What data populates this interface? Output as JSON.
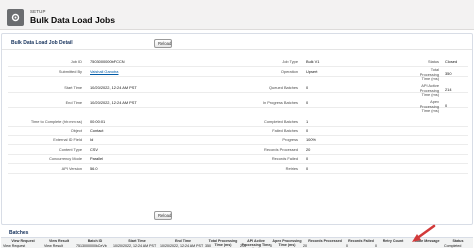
{
  "header": {
    "setup_label": "SETUP",
    "title": "Bulk Data Load Jobs"
  },
  "panel": {
    "title": "Bulk Data Load Job Detail",
    "reload_label": "Reload"
  },
  "detail": {
    "col1": [
      {
        "label": "Job ID",
        "value": "7503000000bFCCN"
      },
      {
        "label": "Submitted By",
        "value": "Vaishali Ganotra",
        "link": true
      },
      {
        "label": "Start Time",
        "value": "10/20/2022, 12:24 AM PST"
      },
      {
        "label": "End Time",
        "value": "10/20/2022, 12:24 AM PST"
      },
      {
        "label": "Time to Complete (hh:mm:ss)",
        "value": "00:00:01"
      },
      {
        "label": "Object",
        "value": "Contact"
      },
      {
        "label": "External ID Field",
        "value": "Id"
      },
      {
        "label": "Content Type",
        "value": "CSV"
      },
      {
        "label": "Concurrency Mode",
        "value": "Parallel"
      },
      {
        "label": "API Version",
        "value": "56.0"
      }
    ],
    "col2": [
      {
        "label": "Job Type",
        "value": "Bulk V1"
      },
      {
        "label": "Operation",
        "value": "Upsert"
      },
      {
        "label": "Queued Batches",
        "value": "0"
      },
      {
        "label": "In Progress Batches",
        "value": "0"
      },
      {
        "label": "Completed Batches",
        "value": "1"
      },
      {
        "label": "Failed Batches",
        "value": "0"
      },
      {
        "label": "Progress",
        "value": "100%"
      },
      {
        "label": "Records Processed",
        "value": "20"
      },
      {
        "label": "Records Failed",
        "value": "0"
      },
      {
        "label": "Retries",
        "value": "0"
      }
    ],
    "col3": [
      {
        "label": "Status",
        "value": "Closed"
      },
      {
        "label": "Total Processing Time (ms)",
        "value": "350"
      },
      {
        "label": "API Active Processing Time (ms)",
        "value": "214"
      },
      {
        "label": "Apex Processing Time (ms)",
        "value": "0"
      }
    ]
  },
  "batches": {
    "title": "Batches",
    "headers": [
      "View Request",
      "View Result",
      "Batch ID",
      "Start Time",
      "End Time",
      "Total Processing Time (ms)",
      "API Active Processing Time (ms)",
      "Apex Processing Time (ms)",
      "Records Processed",
      "Records Failed",
      "Retry Count",
      "State Message",
      "Status"
    ],
    "rows": [
      [
        "View Request",
        "View Result",
        "7513000000kCeVb",
        "10/20/2022, 12:24 AM PST",
        "10/20/2022, 12:24 AM PST",
        "350",
        "214",
        "0",
        "20",
        "0",
        "0",
        "",
        "Completed"
      ]
    ]
  },
  "colors": {
    "link": "#015ba7",
    "arrow": "#d23a3a",
    "title": "#16325c"
  },
  "icons": [
    "setup-gear-icon",
    "red-arrow-annotation"
  ]
}
